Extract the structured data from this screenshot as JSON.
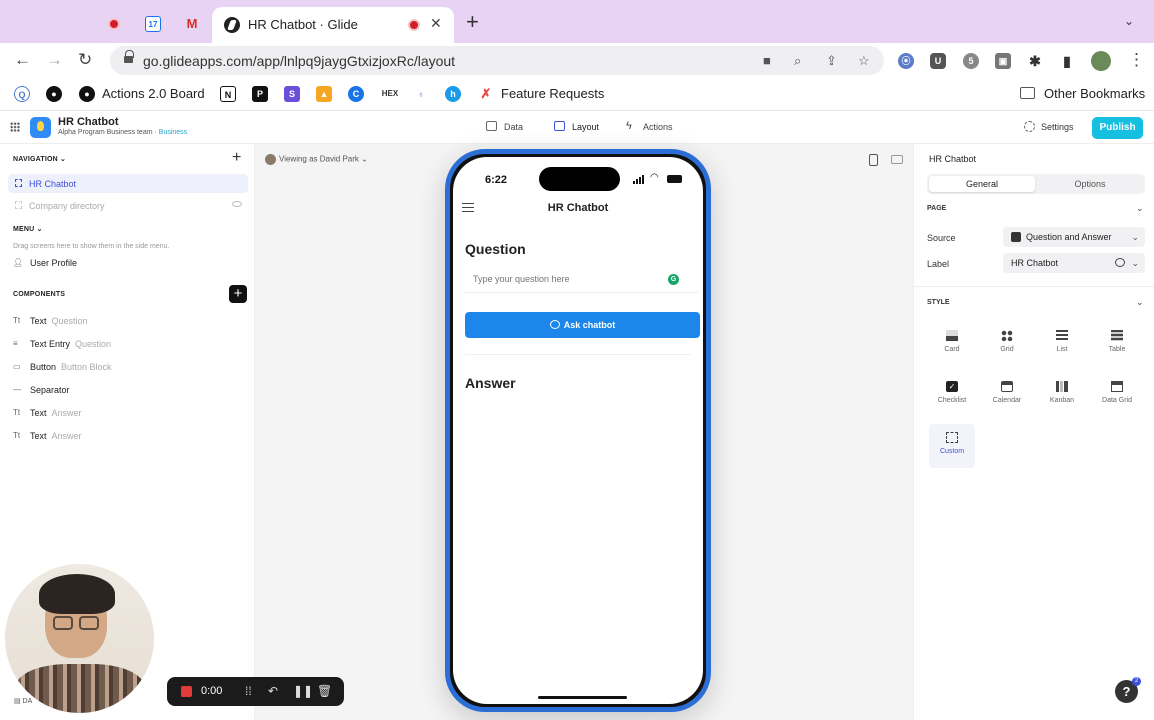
{
  "browser": {
    "active_tab_title": "HR Chatbot · Glide",
    "url": "go.glideapps.com/app/lnlpq9jaygGtxizjoxRc/layout",
    "bookmarks": [
      "Actions 2.0 Board",
      "Feature Requests"
    ],
    "other_bookmarks": "Other Bookmarks",
    "calendar_day": "17"
  },
  "header": {
    "app_name": "HR Chatbot",
    "team": "Alpha Program Business team",
    "plan": "Business",
    "tabs": [
      "Data",
      "Layout",
      "Actions"
    ],
    "settings": "Settings",
    "publish": "Publish"
  },
  "left": {
    "navigation_title": "NAVIGATION",
    "nav_items": [
      {
        "label": "HR Chatbot",
        "selected": true
      },
      {
        "label": "Company directory",
        "hidden": true
      }
    ],
    "menu_title": "MENU",
    "menu_hint": "Drag screens here to show them in the side menu.",
    "menu_items": [
      "User Profile"
    ],
    "components_title": "COMPONENTS",
    "components": [
      {
        "icon": "Tt",
        "type": "Text",
        "name": "Question"
      },
      {
        "icon": "≡",
        "type": "Text Entry",
        "name": "Question"
      },
      {
        "icon": "▭",
        "type": "Button",
        "name": "Button Block"
      },
      {
        "icon": "—",
        "type": "Separator",
        "name": ""
      },
      {
        "icon": "Tt",
        "type": "Text",
        "name": "Answer"
      },
      {
        "icon": "Tt",
        "type": "Text",
        "name": "Answer"
      }
    ]
  },
  "canvas": {
    "viewing_as": "Viewing as David Park",
    "phone": {
      "time": "6:22",
      "screen_title": "HR Chatbot",
      "question_label": "Question",
      "question_placeholder": "Type your question here",
      "ask_button": "Ask chatbot",
      "answer_label": "Answer"
    }
  },
  "right": {
    "title": "HR Chatbot",
    "tabs": [
      "General",
      "Options"
    ],
    "page_section": "PAGE",
    "source_label": "Source",
    "source_value": "Question and Answer",
    "label_label": "Label",
    "label_value": "HR Chatbot",
    "style_section": "STYLE",
    "styles": [
      "Card",
      "Grid",
      "List",
      "Table",
      "Checklist",
      "Calendar",
      "Kanban",
      "Data Grid",
      "Custom"
    ],
    "selected_style": "Custom"
  },
  "recorder": {
    "time": "0:00"
  },
  "help_badge": "2",
  "colors": {
    "accent": "#3f51d9",
    "publish": "#15bfe0",
    "ask_button": "#1c86ea",
    "phone_frame": "#2b6fd6",
    "tabstrip": "#e8d3f5"
  }
}
